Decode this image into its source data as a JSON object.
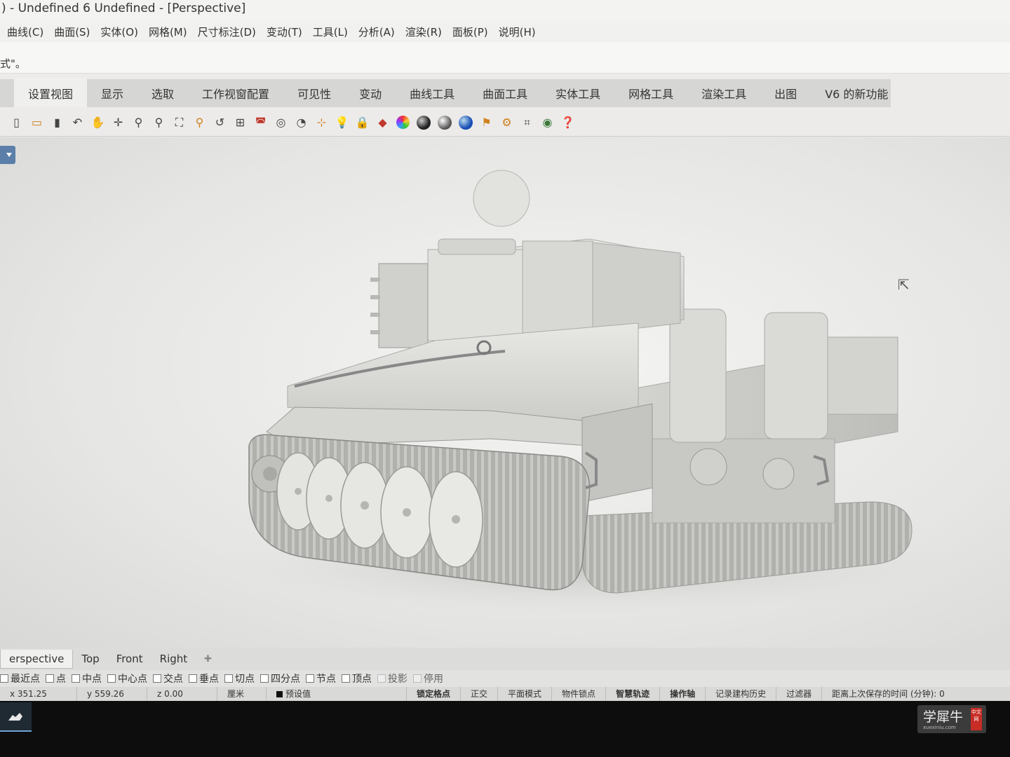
{
  "window": {
    "title": ") - Undefined 6 Undefined - [Perspective]"
  },
  "menubar": {
    "items": [
      "曲线(C)",
      "曲面(S)",
      "实体(O)",
      "网格(M)",
      "尺寸标注(D)",
      "变动(T)",
      "工具(L)",
      "分析(A)",
      "渲染(R)",
      "面板(P)",
      "说明(H)"
    ]
  },
  "command_history": {
    "text": "式\"。"
  },
  "toolbar_tabs": [
    "设置视图",
    "显示",
    "选取",
    "工作视窗配置",
    "可见性",
    "变动",
    "曲线工具",
    "曲面工具",
    "实体工具",
    "网格工具",
    "渲染工具",
    "出图",
    "V6 的新功能"
  ],
  "active_toolbar_tab": "设置视图",
  "toolbar_icons": [
    "new-file-icon",
    "open-file-icon",
    "save-icon",
    "undo-icon",
    "pan-hand-icon",
    "rotate-view-icon",
    "zoom-icon",
    "zoom-dynamic-icon",
    "zoom-extents-icon",
    "zoom-selected-icon",
    "undo-view-icon",
    "four-viewports-icon",
    "car-icon",
    "named-view-icon",
    "camera-icon",
    "set-cplane-icon",
    "light-bulb-icon",
    "lock-icon",
    "material-icon",
    "color-wheel-icon",
    "shaded-sphere-icon",
    "rendered-sphere-icon",
    "blue-sphere-icon",
    "flag-icon",
    "gear-icon",
    "grid-snap-icon",
    "earth-icon",
    "help-icon"
  ],
  "viewport": {
    "name": "Perspective",
    "scene": "tiger-tank-model"
  },
  "viewport_tabs": [
    "erspective",
    "Top",
    "Front",
    "Right"
  ],
  "active_viewport_tab": "erspective",
  "osnaps": [
    {
      "label": "最近点",
      "checked": false,
      "enabled": true
    },
    {
      "label": "点",
      "checked": false,
      "enabled": true
    },
    {
      "label": "中点",
      "checked": false,
      "enabled": true
    },
    {
      "label": "中心点",
      "checked": false,
      "enabled": true
    },
    {
      "label": "交点",
      "checked": false,
      "enabled": true
    },
    {
      "label": "垂点",
      "checked": false,
      "enabled": true
    },
    {
      "label": "切点",
      "checked": false,
      "enabled": true
    },
    {
      "label": "四分点",
      "checked": false,
      "enabled": true
    },
    {
      "label": "节点",
      "checked": false,
      "enabled": true
    },
    {
      "label": "顶点",
      "checked": false,
      "enabled": true
    },
    {
      "label": "投影",
      "checked": false,
      "enabled": false
    },
    {
      "label": "停用",
      "checked": false,
      "enabled": false
    }
  ],
  "status": {
    "x": "x 351.25",
    "y": "y 559.26",
    "z": "z 0.00",
    "units": "厘米",
    "layer": "预设值",
    "grid_snap": "锁定格点",
    "ortho": "正交",
    "planar": "平面模式",
    "osnap": "物件锁点",
    "smarttrack": "智慧轨迹",
    "gumball": "操作轴",
    "history": "记录建构历史",
    "filter": "过滤器",
    "autosave": "距离上次保存的时间 (分钟): 0"
  },
  "watermark": {
    "text": "学犀牛",
    "url": "xuexiniu.com",
    "seal": "中文网"
  },
  "colors": {
    "viewport_bg": "#e9e9e7",
    "model": "#dcdcd8",
    "accent": "#5b7fa8",
    "taskbar": "#0d0d0d"
  }
}
